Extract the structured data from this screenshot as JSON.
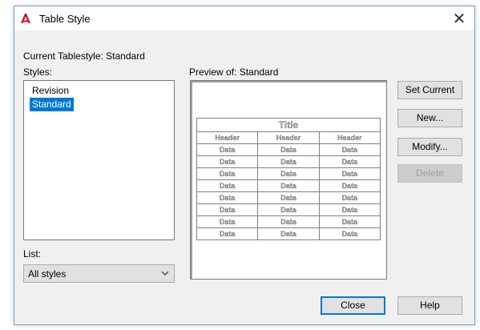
{
  "window": {
    "title": "Table Style",
    "close_symbol": "✕"
  },
  "current_style": {
    "label": "Current Tablestyle: Standard"
  },
  "styles": {
    "label": "Styles:",
    "items": [
      {
        "label": "Revision",
        "selected": false
      },
      {
        "label": "Standard",
        "selected": true
      }
    ]
  },
  "list": {
    "label": "List:",
    "value": "All styles"
  },
  "preview": {
    "label": "Preview of: Standard",
    "table": {
      "title": "Title",
      "headers": [
        "Header",
        "Header",
        "Header"
      ],
      "rows": [
        [
          "Data",
          "Data",
          "Data"
        ],
        [
          "Data",
          "Data",
          "Data"
        ],
        [
          "Data",
          "Data",
          "Data"
        ],
        [
          "Data",
          "Data",
          "Data"
        ],
        [
          "Data",
          "Data",
          "Data"
        ],
        [
          "Data",
          "Data",
          "Data"
        ],
        [
          "Data",
          "Data",
          "Data"
        ],
        [
          "Data",
          "Data",
          "Data"
        ]
      ]
    }
  },
  "buttons": {
    "set_current": "Set Current",
    "new": "New...",
    "modify": "Modify...",
    "delete": "Delete",
    "close": "Close",
    "help": "Help"
  },
  "colors": {
    "accent": "#0078d7",
    "window_border": "#6f9fcf",
    "app_icon": "#c8102e"
  }
}
